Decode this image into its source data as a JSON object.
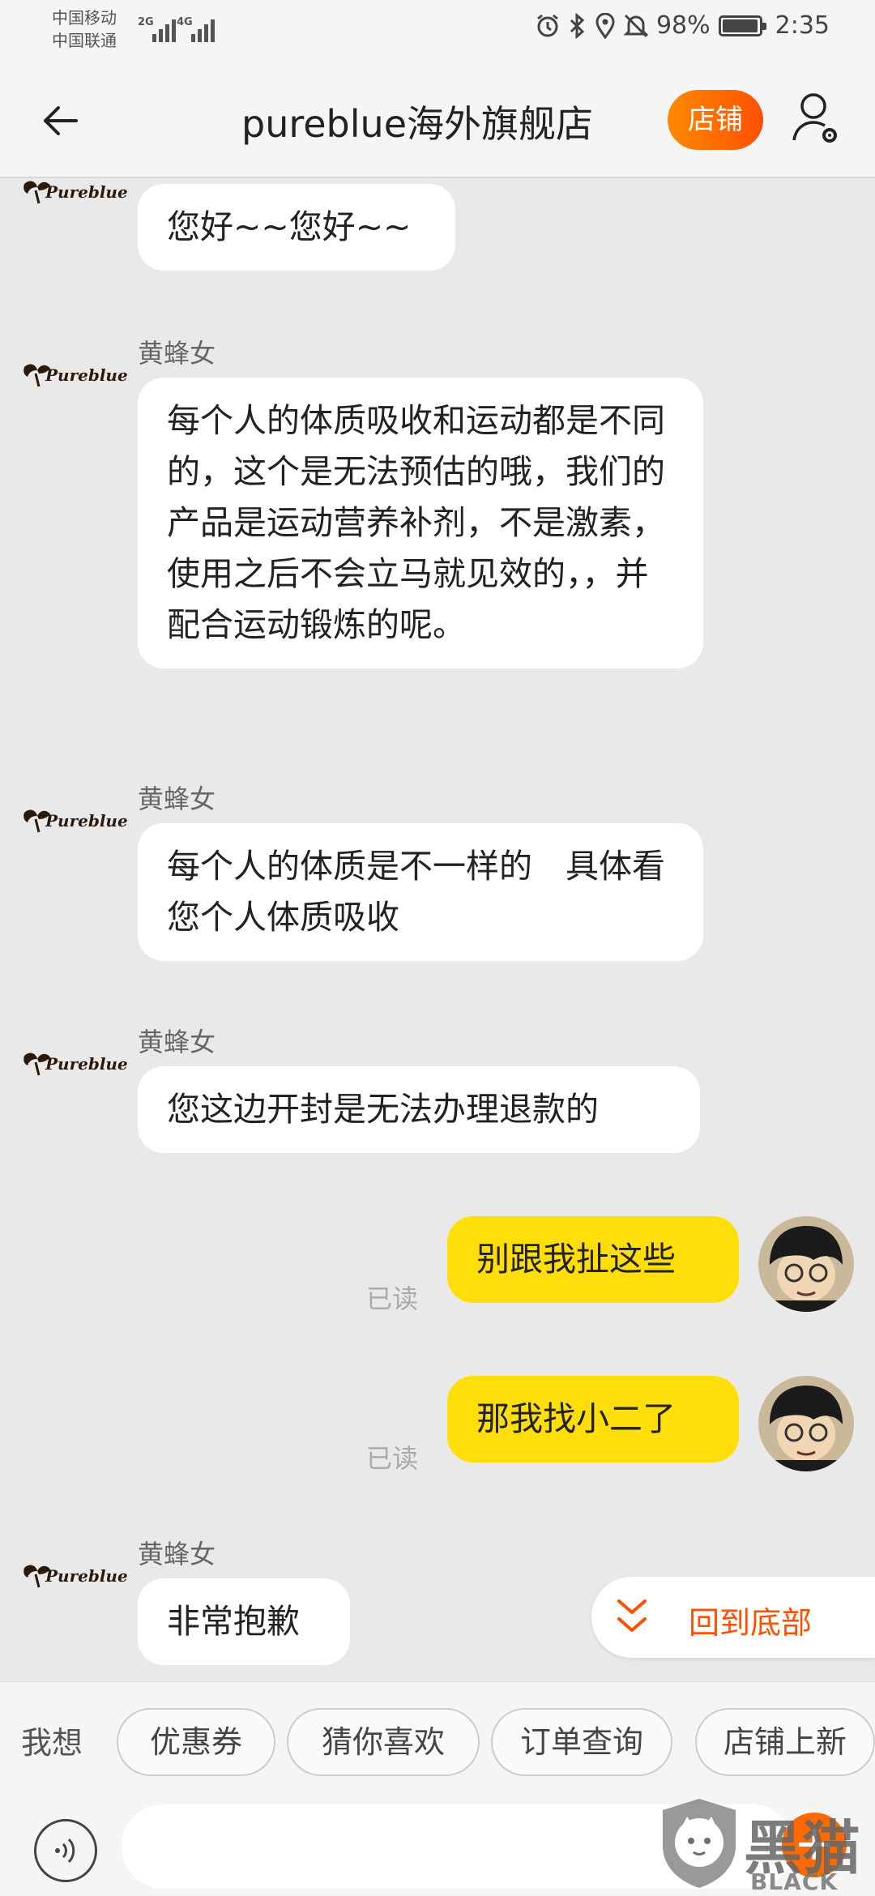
{
  "status_bar": {
    "carrier_1": "中国移动",
    "carrier_2": "中国联通",
    "net_1": "2G",
    "net_2": "4G",
    "battery_text": "98%",
    "battery_level": 0.98,
    "time": "2:35"
  },
  "header": {
    "title": "pureblue海外旗舰店",
    "shop_button": "店铺",
    "back_icon": "arrow-left-icon",
    "profile_icon": "user-settings-icon"
  },
  "shop_logo_text": "Pureblue",
  "messages": [
    {
      "side": "left",
      "sender": "",
      "text": "您好~~您好~~"
    },
    {
      "side": "left",
      "sender": "黄蜂女",
      "text": "每个人的体质吸收和运动都是不同的，这个是无法预估的哦，我们的产品是运动营养补剂，不是激素，使用之后不会立马就见效的，，并配合运动锻炼的呢。"
    },
    {
      "side": "left",
      "sender": "黄蜂女",
      "text": "每个人的体质是不一样的　具体看 您个人体质吸收"
    },
    {
      "side": "left",
      "sender": "黄蜂女",
      "text": "您这边开封是无法办理退款的"
    },
    {
      "side": "right",
      "status": "已读",
      "text": "别跟我扯这些"
    },
    {
      "side": "right",
      "status": "已读",
      "text": "那我找小二了"
    },
    {
      "side": "left",
      "sender": "黄蜂女",
      "text": "非常抱歉"
    }
  ],
  "jump_to_bottom": "回到底部",
  "quick_bar": {
    "label": "我想",
    "chips": [
      "优惠券",
      "猜你喜欢",
      "订单查询",
      "店铺上新"
    ]
  },
  "input": {
    "placeholder": "",
    "add_label": "+"
  },
  "watermark": {
    "brand": "黑猫",
    "sub": "BLACK CAT"
  },
  "colors": {
    "accent": "#ff5000",
    "my_bubble": "#ffde09",
    "background": "#e9e9e9"
  }
}
